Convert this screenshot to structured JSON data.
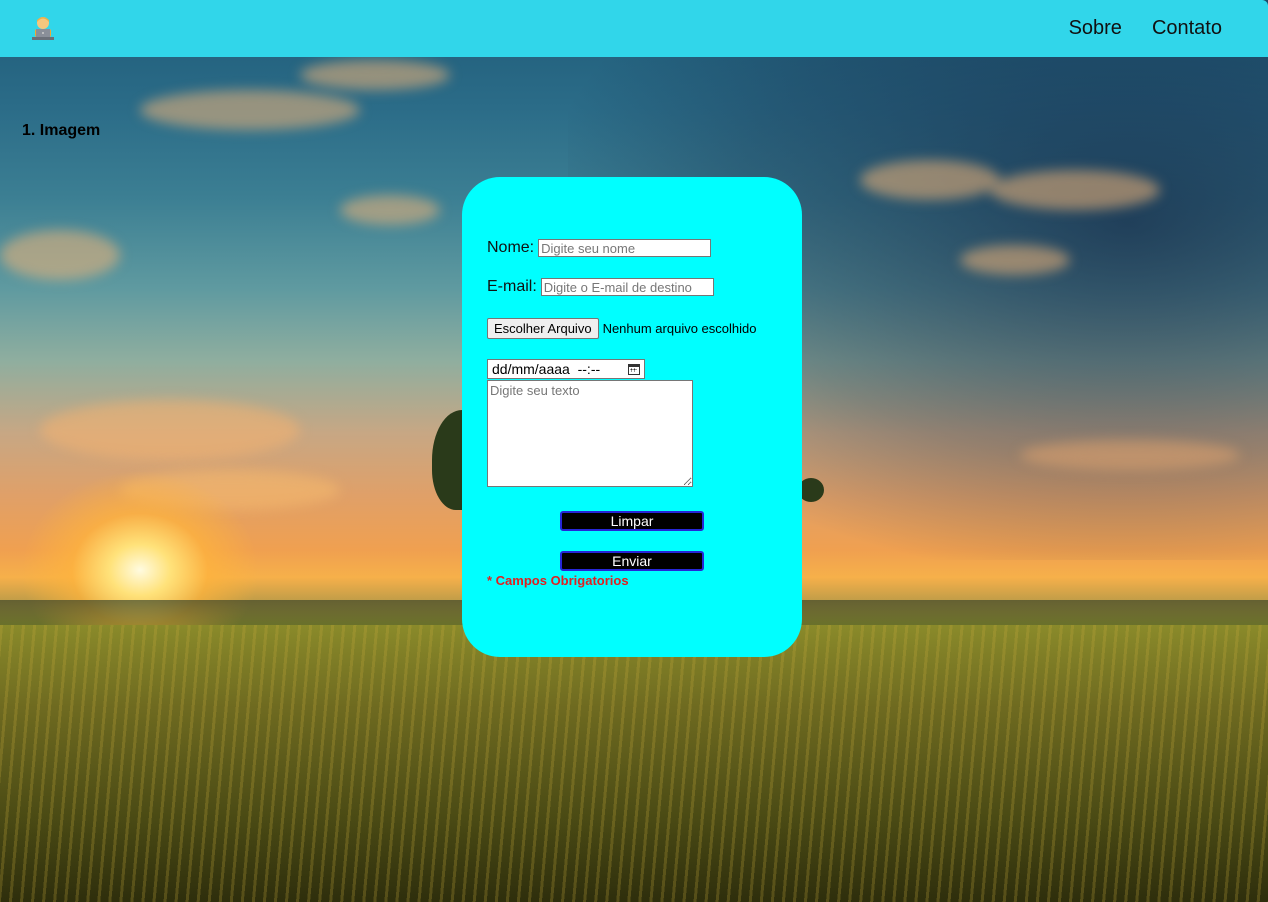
{
  "header": {
    "logo_icon": "person-at-laptop-icon",
    "nav": [
      {
        "label": "Sobre"
      },
      {
        "label": "Contato"
      }
    ],
    "background_color": "#31d6ea"
  },
  "page": {
    "heading": "1. Imagem",
    "background": "sunset-wheat-field-photo"
  },
  "form": {
    "background_color": "#00ffff",
    "name_label": "Nome:",
    "name_placeholder": "Digite seu nome",
    "email_label": "E-mail:",
    "email_placeholder": "Digite o E-mail de destino",
    "file_button": "Escolher Arquivo",
    "file_status": "Nenhum arquivo escolhido",
    "datetime_value": "dd/mm/aaaa  --:--",
    "datetime_icon": "calendar-icon",
    "message_placeholder": "Digite seu texto",
    "clear_button": "Limpar",
    "submit_button": "Enviar",
    "required_note": "* Campos Obrigatorios",
    "required_color": "#e02020"
  }
}
